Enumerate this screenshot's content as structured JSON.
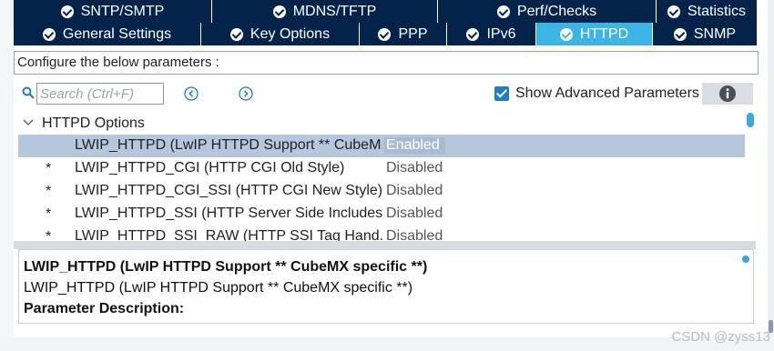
{
  "tabs_row1": [
    {
      "label": "SNTP/SMTP",
      "name": "tab-sntp-smtp"
    },
    {
      "label": "MDNS/TFTP",
      "name": "tab-mdns-tftp"
    },
    {
      "label": "Perf/Checks",
      "name": "tab-perf-checks"
    },
    {
      "label": "Statistics",
      "name": "tab-statistics"
    }
  ],
  "tabs_row2": [
    {
      "label": "General Settings",
      "name": "tab-general-settings"
    },
    {
      "label": "Key Options",
      "name": "tab-key-options"
    },
    {
      "label": "PPP",
      "name": "tab-ppp"
    },
    {
      "label": "IPv6",
      "name": "tab-ipv6"
    },
    {
      "label": "HTTPD",
      "name": "tab-httpd",
      "active": true
    },
    {
      "label": "SNMP",
      "name": "tab-snmp"
    }
  ],
  "configure_label": "Configure the below parameters :",
  "search": {
    "placeholder": "Search (Ctrl+F)"
  },
  "show_advanced": {
    "label": "Show Advanced Parameters",
    "checked": true
  },
  "group": {
    "label": "HTTPD Options",
    "expanded": true
  },
  "params": [
    {
      "star": "",
      "name": "LWIP_HTTPD (LwIP HTTPD Support ** CubeM...",
      "value": "Enabled",
      "selected": true
    },
    {
      "star": "*",
      "name": "LWIP_HTTPD_CGI (HTTP CGI Old Style)",
      "value": "Disabled"
    },
    {
      "star": "*",
      "name": "LWIP_HTTPD_CGI_SSI (HTTP CGI New Style)",
      "value": "Disabled"
    },
    {
      "star": "*",
      "name": "LWIP_HTTPD_SSI (HTTP Server Side Includes)",
      "value": "Disabled"
    },
    {
      "star": "*",
      "name": "LWIP_HTTPD_SSI_RAW (HTTP SSI Tag Hand...",
      "value": "Disabled"
    }
  ],
  "description": {
    "title": "LWIP_HTTPD (LwIP HTTPD Support ** CubeMX specific **)",
    "line": "LWIP_HTTPD (LwIP HTTPD Support ** CubeMX specific **)",
    "param_label": "Parameter Description:"
  },
  "watermark": "CSDN @zyss13",
  "colors": {
    "tab_bg": "#03234b",
    "tab_active": "#3cb4e6",
    "selection": "#b5c7dc",
    "checkbox": "#1f7fc2"
  },
  "icons": {
    "search": "search-icon",
    "prev": "chevron-left-circle-icon",
    "next": "chevron-right-circle-icon",
    "info": "info-icon",
    "caret": "chevron-down-icon",
    "tab_check": "check-circle-icon"
  }
}
